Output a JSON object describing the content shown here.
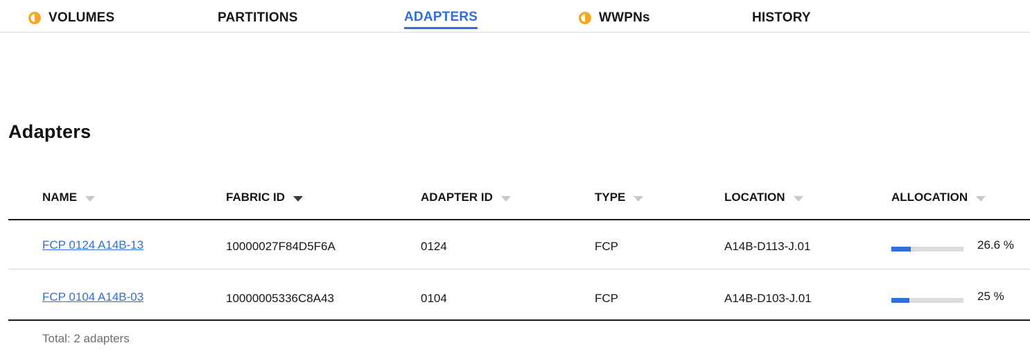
{
  "tabs": [
    {
      "label": "VOLUMES",
      "icon": "warning-half-circle-icon"
    },
    {
      "label": "PARTITIONS"
    },
    {
      "label": "ADAPTERS",
      "active": true
    },
    {
      "label": "WWPNs",
      "icon": "warning-half-circle-icon"
    },
    {
      "label": "HISTORY"
    }
  ],
  "page": {
    "title": "Adapters"
  },
  "table": {
    "columns": [
      "NAME",
      "FABRIC ID",
      "ADAPTER ID",
      "TYPE",
      "LOCATION",
      "ALLOCATION"
    ],
    "sorted_column": "FABRIC ID",
    "rows": [
      {
        "name": "FCP 0124 A14B-13",
        "fabric_id": "10000027F84D5F6A",
        "adapter_id": "0124",
        "type": "FCP",
        "location": "A14B-D113-J.01",
        "allocation_label": "26.6 %",
        "allocation_percent": 26.6
      },
      {
        "name": "FCP 0104 A14B-03",
        "fabric_id": "10000005336C8A43",
        "adapter_id": "0104",
        "type": "FCP",
        "location": "A14B-D103-J.01",
        "allocation_label": "25 %",
        "allocation_percent": 25
      }
    ],
    "footer": "Total: 2 adapters"
  },
  "colors": {
    "accent": "#2e6fd9",
    "warning": "#f5a623",
    "bar_track": "#dcdcdc"
  }
}
